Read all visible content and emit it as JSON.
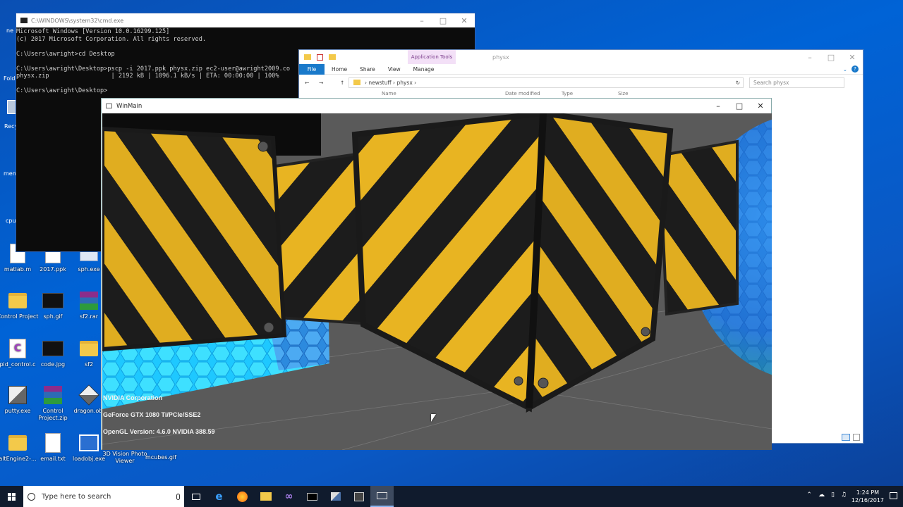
{
  "desktop": {
    "icons": [
      {
        "label": "matlab.m"
      },
      {
        "label": "2017.ppk"
      },
      {
        "label": "sph.exe"
      },
      {
        "label": "Control Project"
      },
      {
        "label": "sph.gif"
      },
      {
        "label": "sf2.rar"
      },
      {
        "label": "pid_control.c"
      },
      {
        "label": "code.jpg"
      },
      {
        "label": "sf2"
      },
      {
        "label": "putty.exe"
      },
      {
        "label": "Control Project.zip"
      },
      {
        "label": "dragon.obj"
      },
      {
        "label": "altEngine2-..."
      },
      {
        "label": "email.txt"
      },
      {
        "label": "loadobj.exe"
      },
      {
        "label": "3D Vision Photo Viewer"
      },
      {
        "label": "mcubes.gif"
      }
    ],
    "clipped_labels": [
      "ne",
      "Folde",
      "Recy",
      "mem",
      "cpu"
    ]
  },
  "cmd": {
    "title": "C:\\WINDOWS\\system32\\cmd.exe",
    "lines": [
      "Microsoft Windows [Version 10.0.16299.125]",
      "(c) 2017 Microsoft Corporation. All rights reserved.",
      "",
      "C:\\Users\\awright>cd Desktop",
      "",
      "C:\\Users\\awright\\Desktop>pscp -i 2017.ppk physx.zip ec2-user@awright2009.co",
      "physx.zip                 | 2192 kB | 1096.1 kB/s | ETA: 00:00:00 | 100%",
      "",
      "C:\\Users\\awright\\Desktop>"
    ]
  },
  "explorer": {
    "title": "physx",
    "app_tools": "Application Tools",
    "ribbon": {
      "file": "File",
      "home": "Home",
      "share": "Share",
      "view": "View",
      "manage": "Manage"
    },
    "path": [
      "newstuff",
      "physx"
    ],
    "search_placeholder": "Search physx",
    "columns": [
      "Name",
      "Date modified",
      "Type",
      "Size"
    ]
  },
  "winmain": {
    "title": "WinMain",
    "overlay": {
      "vendor": "NVIDIA Corporation",
      "renderer": "GeForce GTX 1080 Ti/PCIe/SSE2",
      "version": "OpenGL Version: 4.6.0 NVIDIA 388.59"
    }
  },
  "taskbar": {
    "search_placeholder": "Type here to search",
    "time": "1:24 PM",
    "date": "12/16/2017",
    "apps": [
      "task-view",
      "edge",
      "firefox",
      "file-explorer",
      "visual-studio",
      "cmd",
      "putty",
      "app-icon",
      "winmain"
    ]
  },
  "colors": {
    "desktop": "#0063d6",
    "stripe_yellow": "#e8b422",
    "stripe_black": "#1c1c1c",
    "floor": "#5d5d5d"
  }
}
